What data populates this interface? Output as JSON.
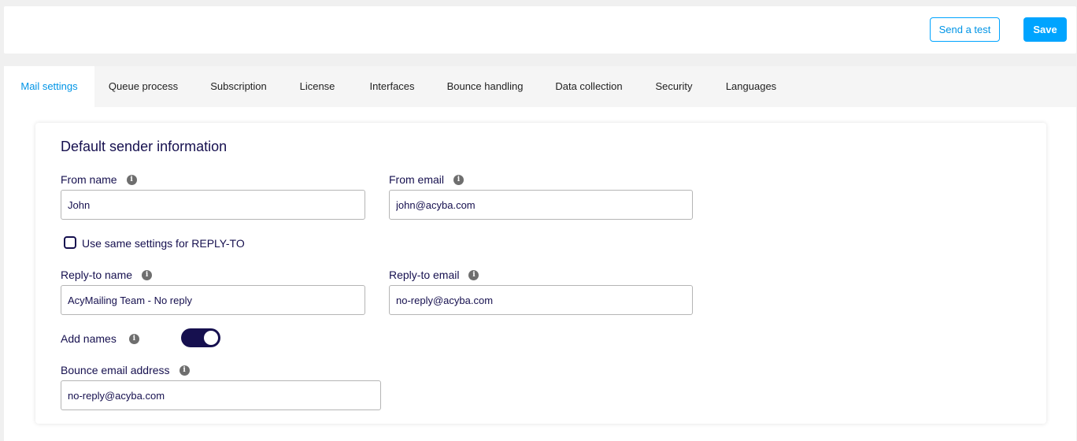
{
  "header": {
    "send_test_label": "Send a test",
    "save_label": "Save"
  },
  "tabs": [
    {
      "label": "Mail settings",
      "active": true
    },
    {
      "label": "Queue process"
    },
    {
      "label": "Subscription"
    },
    {
      "label": "License"
    },
    {
      "label": "Interfaces"
    },
    {
      "label": "Bounce handling"
    },
    {
      "label": "Data collection"
    },
    {
      "label": "Security"
    },
    {
      "label": "Languages"
    }
  ],
  "sender": {
    "title": "Default sender information",
    "from_name_label": "From name",
    "from_name_value": "John",
    "from_email_label": "From email",
    "from_email_value": "john@acyba.com",
    "same_reply_label": "Use same settings for REPLY-TO",
    "same_reply_checked": false,
    "reply_name_label": "Reply-to name",
    "reply_name_value": "AcyMailing Team - No reply",
    "reply_email_label": "Reply-to email",
    "reply_email_value": "no-reply@acyba.com",
    "add_names_label": "Add names",
    "add_names_on": true,
    "bounce_label": "Bounce email address",
    "bounce_value": "no-reply@acyba.com",
    "info_glyph": "i"
  },
  "colors": {
    "accent": "#00a4ff",
    "navy": "#16104f",
    "tab_bg": "#f5f5f5",
    "page_bg": "#f0f0f0"
  },
  "icons": {
    "info": "info-icon"
  }
}
